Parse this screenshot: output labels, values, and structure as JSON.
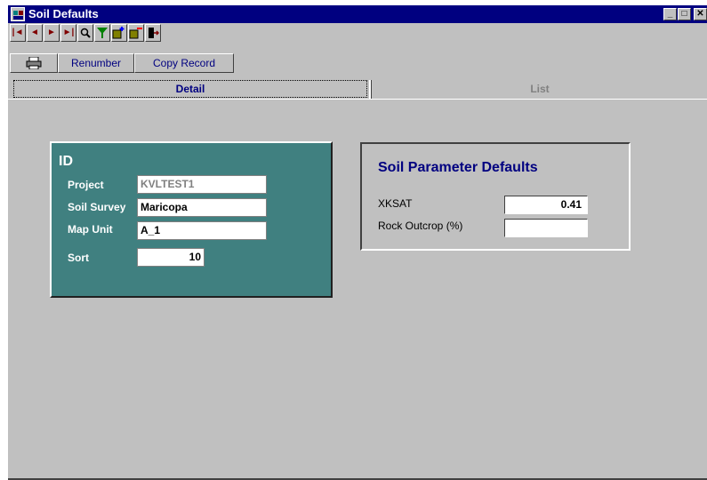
{
  "window": {
    "title": "Soil Defaults",
    "controls": {
      "minimize": "_",
      "maximize": "□",
      "close": "✕"
    }
  },
  "toolbar": {
    "buttons": [
      {
        "name": "first-record-icon",
        "glyph": "◄"
      },
      {
        "name": "prev-record-icon",
        "glyph": "◄"
      },
      {
        "name": "next-record-icon",
        "glyph": "►"
      },
      {
        "name": "last-record-icon",
        "glyph": "►"
      },
      {
        "name": "find-icon",
        "glyph": "🔍"
      },
      {
        "name": "filter-icon",
        "glyph": "▼"
      },
      {
        "name": "add-record-icon",
        "glyph": "+"
      },
      {
        "name": "delete-record-icon",
        "glyph": "−"
      },
      {
        "name": "exit-icon",
        "glyph": "⇥"
      }
    ],
    "accent_colors": {
      "nav": "#800000",
      "filter": "#008000",
      "add_delete": "#808000"
    }
  },
  "buttonbar": {
    "print_icon": "printer-icon",
    "renumber_label": "Renumber",
    "copy_label": "Copy Record"
  },
  "tabs": {
    "detail": "Detail",
    "list": "List"
  },
  "id_panel": {
    "title": "ID",
    "project_label": "Project",
    "project_value": "KVLTEST1",
    "survey_label": "Soil Survey",
    "survey_value": "Maricopa",
    "mapunit_label": "Map Unit",
    "mapunit_value": "A_1",
    "sort_label": "Sort",
    "sort_value": "10",
    "bg_color": "#408080"
  },
  "param_panel": {
    "title": "Soil Parameter Defaults",
    "xksat_label": "XKSAT",
    "xksat_value": "0.41",
    "rock_label": "Rock Outcrop (%)",
    "rock_value": "",
    "title_color": "#000080"
  }
}
